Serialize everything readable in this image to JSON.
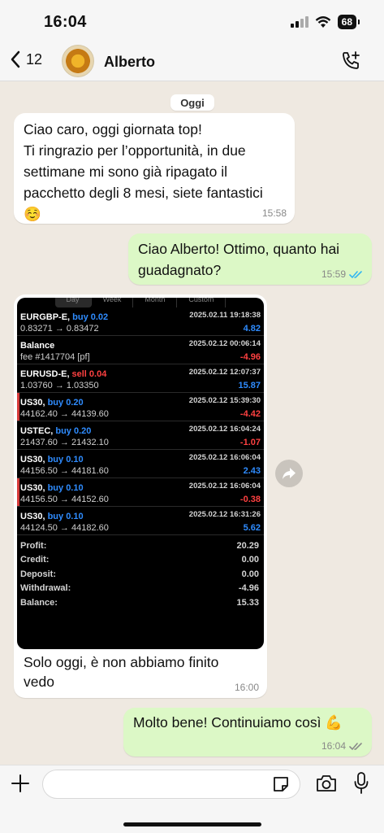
{
  "status_bar": {
    "time": "16:04",
    "battery": "68"
  },
  "header": {
    "back_count": "12",
    "contact_name": "Alberto"
  },
  "chat": {
    "date_pill": "Oggi",
    "messages": [
      {
        "id": "b1",
        "direction": "in",
        "lines": [
          "Ciao caro, oggi giornata top!",
          "Ti ringrazio per l’opportunità, in due",
          "settimane mi sono già ripagato il",
          "pacchetto degli 8 mesi, siete fantastici",
          "☺️"
        ],
        "time": "15:58"
      },
      {
        "id": "b2",
        "direction": "out",
        "lines": [
          "Ciao Alberto! Ottimo, quanto hai",
          "guadagnato?"
        ],
        "time": "15:59",
        "read": true
      },
      {
        "id": "b3",
        "direction": "in",
        "caption_lines": [
          "Solo oggi, è non abbiamo finito",
          "vedo"
        ],
        "time": "16:00"
      },
      {
        "id": "b4",
        "direction": "out",
        "lines": [
          "Molto bene! Continuiamo così 💪"
        ],
        "time": "16:04",
        "read": false
      }
    ]
  },
  "trade_screenshot": {
    "tabs": [
      "Day",
      "Week",
      "Month",
      "Custom"
    ],
    "rows": [
      {
        "symbol": "EURGBP-E,",
        "side": "buy 0.02",
        "side_type": "buy",
        "date": "2025.02.11 19:18:38",
        "prices": "0.83271 → 0.83472",
        "pnl": "4.82",
        "pnl_type": "pos",
        "marked": false
      },
      {
        "symbol": "Balance",
        "side": "",
        "side_type": "",
        "date": "2025.02.12 00:06:14",
        "prices": "fee #1417704 [pf]",
        "pnl": "-4.96",
        "pnl_type": "neg",
        "marked": false
      },
      {
        "symbol": "EURUSD-E,",
        "side": "sell 0.04",
        "side_type": "sell",
        "date": "2025.02.12 12:07:37",
        "prices": "1.03760 → 1.03350",
        "pnl": "15.87",
        "pnl_type": "pos",
        "marked": false
      },
      {
        "symbol": "US30,",
        "side": "buy 0.20",
        "side_type": "buy",
        "date": "2025.02.12 15:39:30",
        "prices": "44162.40 → 44139.60",
        "pnl": "-4.42",
        "pnl_type": "neg",
        "marked": true
      },
      {
        "symbol": "USTEC,",
        "side": "buy 0.20",
        "side_type": "buy",
        "date": "2025.02.12 16:04:24",
        "prices": "21437.60 → 21432.10",
        "pnl": "-1.07",
        "pnl_type": "neg",
        "marked": false
      },
      {
        "symbol": "US30,",
        "side": "buy 0.10",
        "side_type": "buy",
        "date": "2025.02.12 16:06:04",
        "prices": "44156.50 → 44181.60",
        "pnl": "2.43",
        "pnl_type": "pos",
        "marked": false
      },
      {
        "symbol": "US30,",
        "side": "buy 0.10",
        "side_type": "buy",
        "date": "2025.02.12 16:06:04",
        "prices": "44156.50 → 44152.60",
        "pnl": "-0.38",
        "pnl_type": "neg",
        "marked": true
      },
      {
        "symbol": "US30,",
        "side": "buy 0.10",
        "side_type": "buy",
        "date": "2025.02.12 16:31:26",
        "prices": "44124.50 → 44182.60",
        "pnl": "5.62",
        "pnl_type": "pos",
        "marked": false
      }
    ],
    "summary": [
      {
        "label": "Profit:",
        "value": "20.29"
      },
      {
        "label": "Credit:",
        "value": "0.00"
      },
      {
        "label": "Deposit:",
        "value": "0.00"
      },
      {
        "label": "Withdrawal:",
        "value": "-4.96"
      },
      {
        "label": "Balance:",
        "value": "15.33"
      }
    ]
  },
  "input_bar": {
    "placeholder": ""
  },
  "colors": {
    "incoming_bubble": "#ffffff",
    "outgoing_bubble": "#dcf8c6",
    "read_tick": "#34b7f1",
    "wallpaper": "#efe9e1",
    "buy": "#2f8cff",
    "sell": "#ff4141"
  },
  "icons": [
    "back-chevron-icon",
    "add-call-icon",
    "forward-icon",
    "plus-icon",
    "sticker-icon",
    "camera-icon",
    "mic-icon",
    "double-check-icon"
  ]
}
